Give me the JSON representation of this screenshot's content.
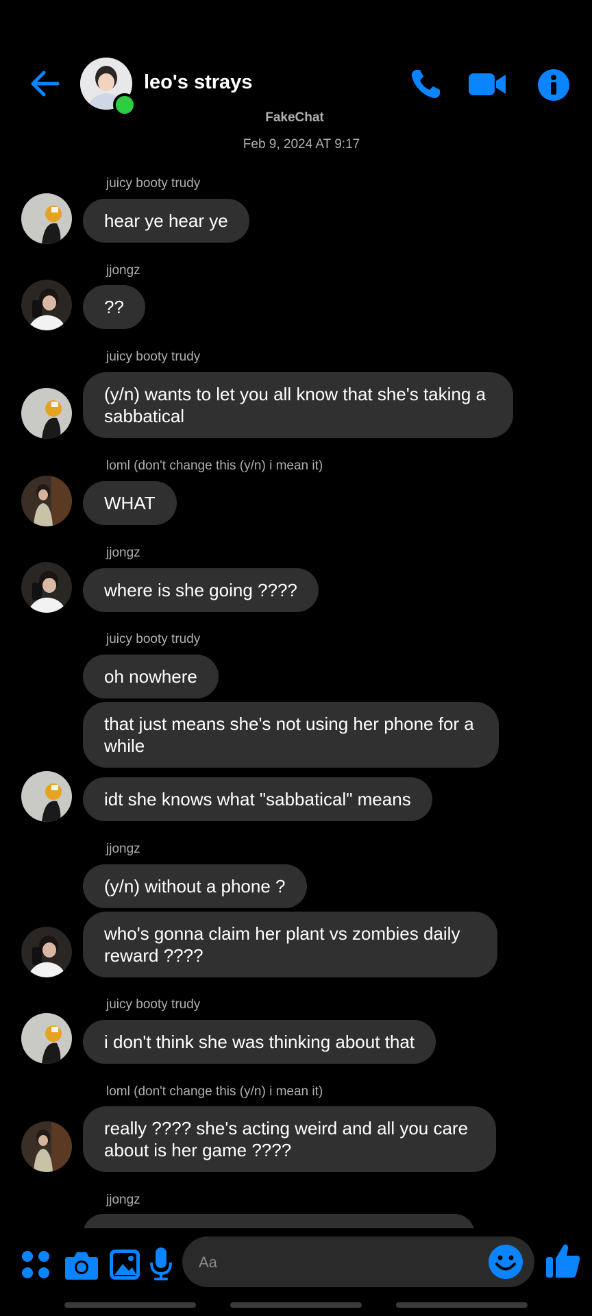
{
  "colors": {
    "accent": "#0a84ff",
    "bubble": "#303030",
    "online": "#2ecc40"
  },
  "header": {
    "title": "leo's strays",
    "back_icon": "arrow-left-icon",
    "call_icon": "phone-icon",
    "video_icon": "video-camera-icon",
    "info_icon": "info-icon"
  },
  "brand": "FakeChat",
  "timestamp": "Feb 9, 2024 AT 9:17",
  "messages": [
    {
      "sender": "juicy booty trudy",
      "lines": [
        "hear ye hear ye"
      ]
    },
    {
      "sender": "jjongz",
      "lines": [
        "??"
      ]
    },
    {
      "sender": "juicy booty trudy",
      "lines": [
        "(y/n) wants to let you all know that she's taking a sabbatical"
      ]
    },
    {
      "sender": "loml (don't change this (y/n) i mean it)",
      "lines": [
        "WHAT"
      ]
    },
    {
      "sender": "jjongz",
      "lines": [
        "where is she going ????"
      ]
    },
    {
      "sender": "juicy booty trudy",
      "lines": [
        "oh nowhere",
        "that just means she's not using her phone for a while",
        "idt she knows what \"sabbatical\" means"
      ]
    },
    {
      "sender": "jjongz",
      "lines": [
        "(y/n) without a phone ?",
        "who's gonna claim her plant vs zombies daily reward ????"
      ]
    },
    {
      "sender": "juicy booty trudy",
      "lines": [
        "i don't think she was thinking about that"
      ]
    },
    {
      "sender": "loml (don't change this (y/n) i mean it)",
      "lines": [
        "really ???? she's acting weird and all you care about is her game ????"
      ]
    },
    {
      "sender": "jjongz",
      "lines": []
    }
  ],
  "composer": {
    "placeholder": "Aa",
    "apps_icon": "apps-grid-icon",
    "camera_icon": "camera-icon",
    "gallery_icon": "gallery-icon",
    "mic_icon": "microphone-icon",
    "emoji_icon": "emoji-icon",
    "like_icon": "thumbs-up-icon"
  }
}
